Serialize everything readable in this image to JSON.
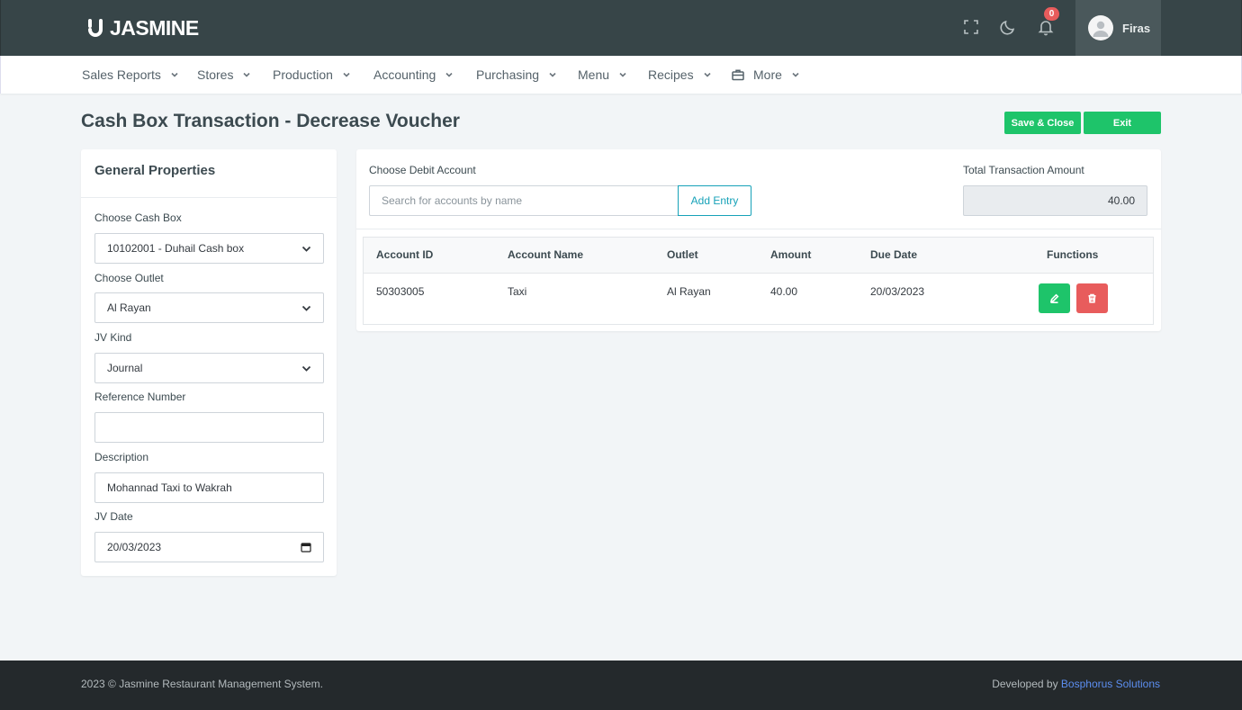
{
  "brand": {
    "name": "JASMINE"
  },
  "topbar": {
    "icons": [
      "fullscreen-icon",
      "moon-icon",
      "bell-icon"
    ],
    "notification_count": "0",
    "user_name": "Firas"
  },
  "nav": {
    "items": [
      {
        "label": "Sales Reports"
      },
      {
        "label": "Stores"
      },
      {
        "label": "Production"
      },
      {
        "label": "Accounting"
      },
      {
        "label": "Purchasing"
      },
      {
        "label": "Menu"
      },
      {
        "label": "Recipes"
      },
      {
        "label": "More"
      }
    ]
  },
  "page": {
    "title": "Cash Box Transaction - Decrease Voucher",
    "save_label": "Save & Close",
    "exit_label": "Exit"
  },
  "general": {
    "header": "General Properties",
    "cash_box_label": "Choose Cash Box",
    "cash_box_value": "10102001 - Duhail Cash box",
    "outlet_label": "Choose Outlet",
    "outlet_value": "Al Rayan",
    "jv_kind_label": "JV Kind",
    "jv_kind_value": "Journal",
    "reference_label": "Reference Number",
    "reference_value": "",
    "description_label": "Description",
    "description_value": "Mohannad Taxi to Wakrah",
    "jv_date_label": "JV Date",
    "jv_date_value": "20/03/2023"
  },
  "entry": {
    "debit_label": "Choose Debit Account",
    "search_placeholder": "Search for accounts by name",
    "add_entry_label": "Add Entry",
    "total_label": "Total Transaction Amount",
    "total_value": "40.00"
  },
  "table": {
    "headers": {
      "account_id": "Account ID",
      "account_name": "Account Name",
      "outlet": "Outlet",
      "amount": "Amount",
      "due_date": "Due Date",
      "functions": "Functions"
    },
    "rows": [
      {
        "account_id": "50303005",
        "account_name": "Taxi",
        "outlet": "Al Rayan",
        "amount": "40.00",
        "due_date": "20/03/2023"
      }
    ]
  },
  "footer": {
    "copyright": "2023 © Jasmine Restaurant Management System.",
    "developed_prefix": "Developed by ",
    "developer": "Bosphorus Solutions"
  },
  "colors": {
    "topbar": "#374548",
    "accent_green": "#1ec46a",
    "danger_red": "#e85c5c",
    "info_teal": "#17a2b8",
    "footer": "#24292c",
    "link_blue": "#5c8ef0"
  }
}
